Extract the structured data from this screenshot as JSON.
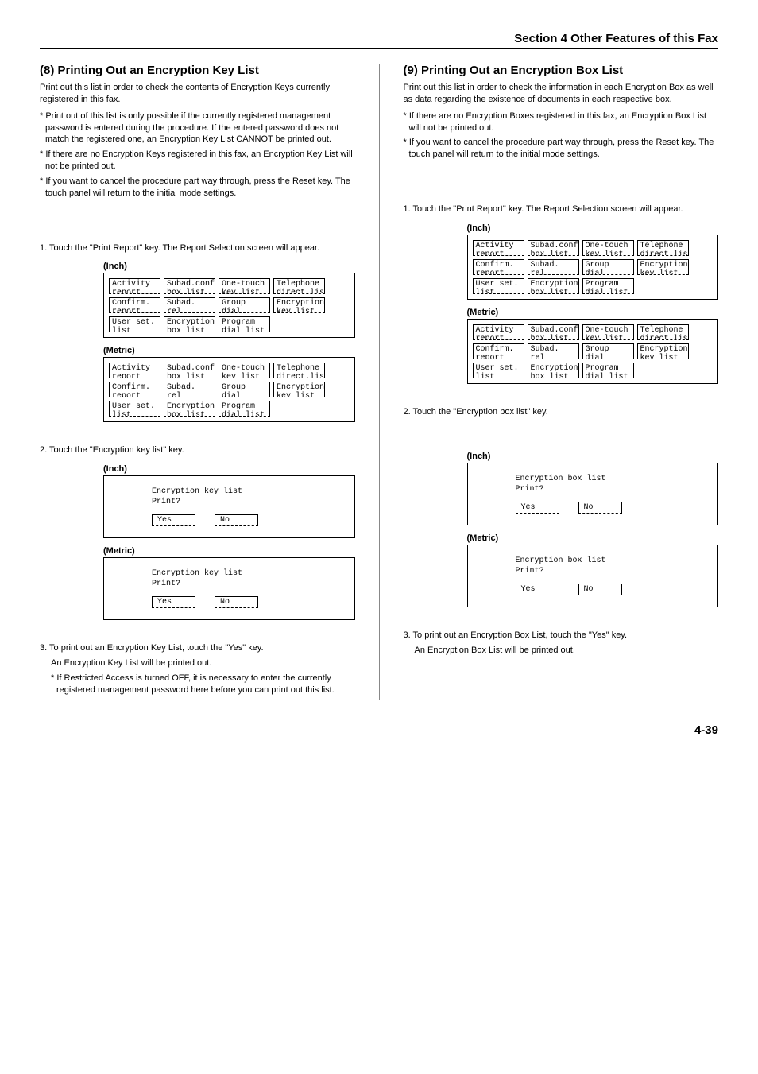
{
  "header": "Section 4 Other Features of this Fax",
  "page_number": "4-39",
  "left": {
    "title": "(8) Printing Out an Encryption Key List",
    "intro": "Print out this list in order to check the contents of Encryption Keys currently registered in this fax.",
    "notes": [
      "* Print out of this list is only possible if the currently registered management password is entered during the procedure. If the entered password does not match the registered one, an Encryption Key List CANNOT be printed out.",
      "* If there are no Encryption Keys registered in this fax, an Encryption Key List will not be printed out.",
      "* If you want to cancel the procedure part way through, press the Reset key. The touch panel will return to the initial mode settings."
    ],
    "step1": "1. Touch the \"Print Report\" key. The Report Selection screen will appear.",
    "labels": {
      "inch": "(Inch)",
      "metric": "(Metric)"
    },
    "panel_rows": [
      [
        "Activity\nreport",
        "Subad.conf\nbox list",
        "One-touch\nkey list",
        "Telephone\ndirect.list"
      ],
      [
        "Confirm.\nreport",
        "Subad. rel\nbox list",
        "Group dial\nList",
        "Encryption\nkey list"
      ],
      [
        "User set.\nlist",
        "Encryption\nbox list",
        "Program\ndial list"
      ]
    ],
    "step2": "2. Touch the \"Encryption key list\" key.",
    "confirm": {
      "line1": "Encryption key list",
      "line2": "Print?",
      "yes": "Yes",
      "no": "No"
    },
    "step3": "3. To print out an Encryption Key List, touch the \"Yes\" key.",
    "step3b": "An Encryption Key List will be printed out.",
    "step3note": "* If Restricted Access is turned OFF, it is necessary to enter the currently registered management password here before you can print out this list."
  },
  "right": {
    "title": "(9) Printing Out an Encryption Box List",
    "intro": "Print out this list in order to check the information in each Encryption Box as well as data regarding the existence of documents in each respective box.",
    "notes": [
      "* If there are no Encryption Boxes registered in this fax, an Encryption Box List will not be printed out.",
      "* If you want to cancel the procedure part way through, press the Reset key. The touch panel will return to the initial mode settings."
    ],
    "step1": "1. Touch the \"Print Report\" key. The Report Selection screen will appear.",
    "labels": {
      "inch": "(Inch)",
      "metric": "(Metric)"
    },
    "panel_rows": [
      [
        "Activity\nreport",
        "Subad.conf\nbox list",
        "One-touch\nkey list",
        "Telephone\ndirect.list"
      ],
      [
        "Confirm.\nreport",
        "Subad. rel\nbox list",
        "Group dial\nList",
        "Encryption\nkey list"
      ],
      [
        "User set.\nlist",
        "Encryption\nbox list",
        "Program\ndial list"
      ]
    ],
    "step2": "2. Touch the \"Encryption box list\" key.",
    "confirm": {
      "line1": "Encryption box list",
      "line2": "Print?",
      "yes": "Yes",
      "no": "No"
    },
    "step3": "3. To print out an Encryption Box List, touch the \"Yes\" key.",
    "step3b": "An Encryption Box List will be printed out."
  }
}
